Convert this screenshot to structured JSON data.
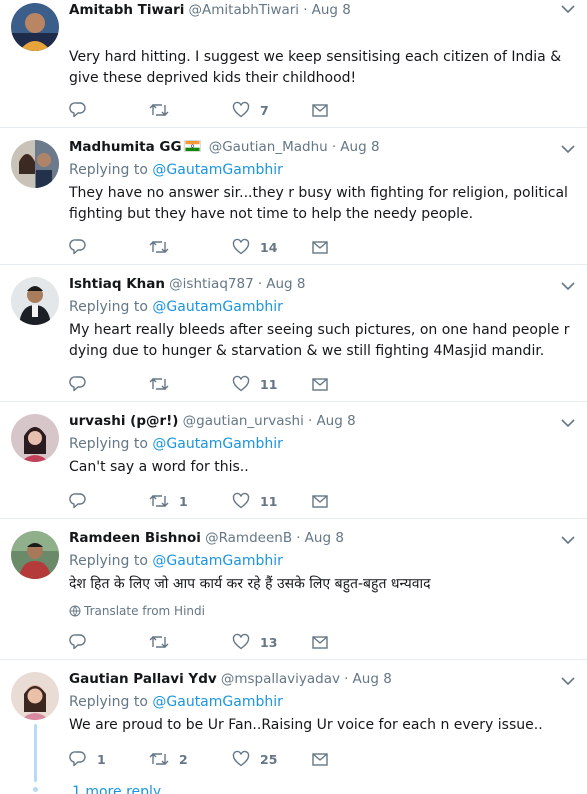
{
  "tweets": [
    {
      "name": "Amitabh Tiwari",
      "handle": "@AmitabhTiwari",
      "dot": "·",
      "time": "Aug 8",
      "replying_prefix": "",
      "replying_to": "",
      "text": "Very hard hitting. I suggest we keep sensitising each citizen of India & give these deprived kids their childhood!",
      "reply_count": "",
      "retweet_count": "",
      "like_count": "7"
    },
    {
      "name": "Madhumita GG",
      "handle": "@Gautian_Madhu",
      "dot": "·",
      "time": "Aug 8",
      "replying_prefix": "Replying to",
      "replying_to": "@GautamGambhir",
      "text": "They have no answer sir...they r busy with fighting for religion, political fighting but they have not time to help the needy people.",
      "reply_count": "",
      "retweet_count": "",
      "like_count": "14"
    },
    {
      "name": "Ishtiaq Khan",
      "handle": "@ishtiaq787",
      "dot": "·",
      "time": "Aug 8",
      "replying_prefix": "Replying to",
      "replying_to": "@GautamGambhir",
      "text": "My heart really bleeds after seeing such pictures, on one hand people r dying due to hunger & starvation & we still fighting 4Masjid mandir.",
      "reply_count": "",
      "retweet_count": "",
      "like_count": "11"
    },
    {
      "name": "urvashi (p@r!)",
      "handle": "@gautian_urvashi",
      "dot": "·",
      "time": "Aug 8",
      "replying_prefix": "Replying to",
      "replying_to": "@GautamGambhir",
      "text": "Can't say a word for this..",
      "reply_count": "",
      "retweet_count": "1",
      "like_count": "11"
    },
    {
      "name": "Ramdeen Bishnoi",
      "handle": "@RamdeenB",
      "dot": "·",
      "time": "Aug 8",
      "replying_prefix": "Replying to",
      "replying_to": "@GautamGambhir",
      "text": "देश हित के लिए जो आप कार्य कर रहे हैं उसके लिए बहुत-बहुत धन्यवाद",
      "translate": "Translate from Hindi",
      "reply_count": "",
      "retweet_count": "",
      "like_count": "13"
    },
    {
      "name": "Gautian Pallavi Ydv",
      "handle": "@mspallaviyadav",
      "dot": "·",
      "time": "Aug 8",
      "replying_prefix": "Replying to",
      "replying_to": "@GautamGambhir",
      "text": "We are proud to be Ur Fan..Raising Ur voice for each n every issue..",
      "reply_count": "1",
      "retweet_count": "2",
      "like_count": "25"
    }
  ],
  "more_replies": "1 more reply",
  "colors": {
    "link": "#1b95e0",
    "muted": "#657786",
    "text": "#14171a",
    "divider": "#e6ecf0",
    "thread": "#b6dbf5"
  },
  "icons": [
    "reply-icon",
    "retweet-icon",
    "like-icon",
    "message-icon",
    "chevron-down-icon",
    "globe-icon",
    "india-flag-icon"
  ]
}
